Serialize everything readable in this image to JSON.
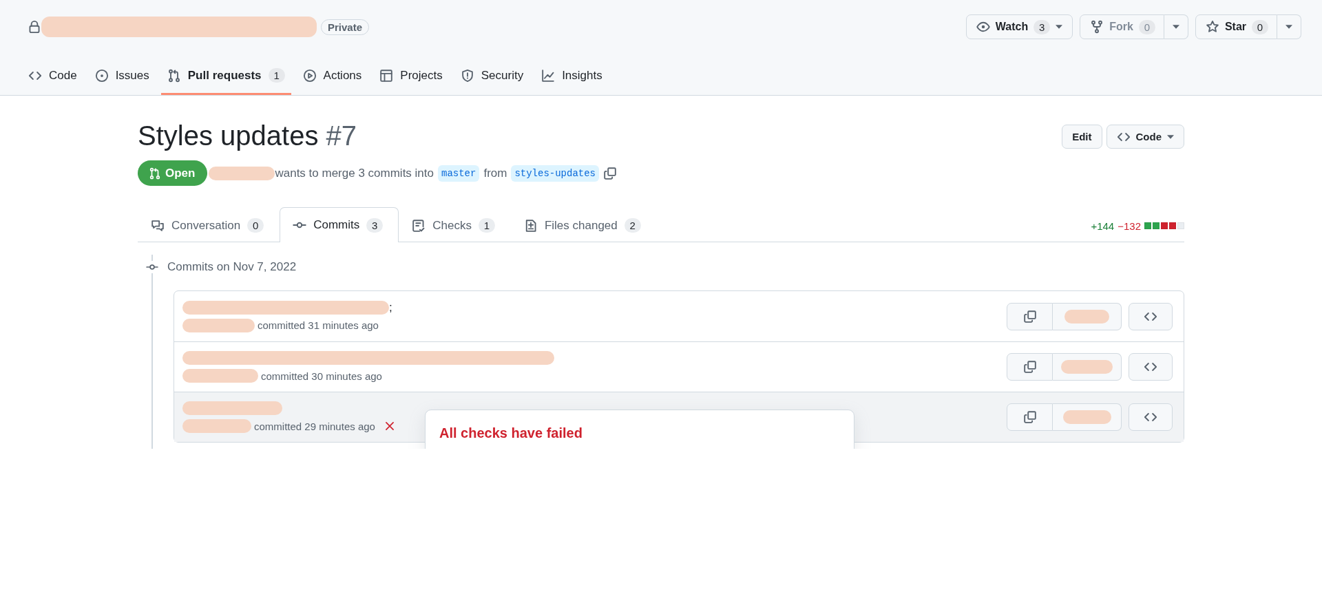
{
  "repo": {
    "visibility": "Private"
  },
  "repo_actions": [
    {
      "kind": "watch",
      "label": "Watch",
      "count": "3",
      "disabled": false
    },
    {
      "kind": "fork",
      "label": "Fork",
      "count": "0",
      "disabled": true
    },
    {
      "kind": "star",
      "label": "Star",
      "count": "0",
      "disabled": false
    }
  ],
  "nav": [
    {
      "label": "Code",
      "selected": false
    },
    {
      "label": "Issues",
      "selected": false
    },
    {
      "label": "Pull requests",
      "count": "1",
      "selected": true
    },
    {
      "label": "Actions",
      "selected": false
    },
    {
      "label": "Projects",
      "selected": false
    },
    {
      "label": "Security",
      "selected": false
    },
    {
      "label": "Insights",
      "selected": false
    }
  ],
  "pull_request": {
    "title": "Styles updates",
    "number": "#7",
    "state": "Open",
    "summary": "wants to merge 3 commits into",
    "base": "master",
    "from_word": "from",
    "head": "styles-updates"
  },
  "header_buttons": [
    {
      "kind": "plain",
      "label": "Edit"
    },
    {
      "kind": "code",
      "label": "Code"
    }
  ],
  "tabs": [
    {
      "label": "Conversation",
      "count": "0",
      "selected": false
    },
    {
      "label": "Commits",
      "count": "3",
      "selected": true
    },
    {
      "label": "Checks",
      "count": "1",
      "selected": false
    },
    {
      "label": "Files changed",
      "count": "2",
      "selected": false
    }
  ],
  "diffstat": {
    "additions": "+144",
    "deletions": "−132",
    "blocks": [
      {
        "kind": "add"
      },
      {
        "kind": "add"
      },
      {
        "kind": "del"
      },
      {
        "kind": "del"
      },
      {
        "kind": "neutral"
      }
    ]
  },
  "commit_group": {
    "heading": "Commits on Nov 7, 2022",
    "commits": [
      {
        "message_tail": ";",
        "meta": "committed 31 minutes ago",
        "checks_failed": false,
        "highlighted": false
      },
      {
        "meta": "committed 30 minutes ago",
        "checks_failed": false,
        "highlighted": false
      },
      {
        "meta": "committed 29 minutes ago",
        "checks_failed": true,
        "highlighted": true
      }
    ]
  },
  "popover": {
    "title": "All checks have failed"
  }
}
